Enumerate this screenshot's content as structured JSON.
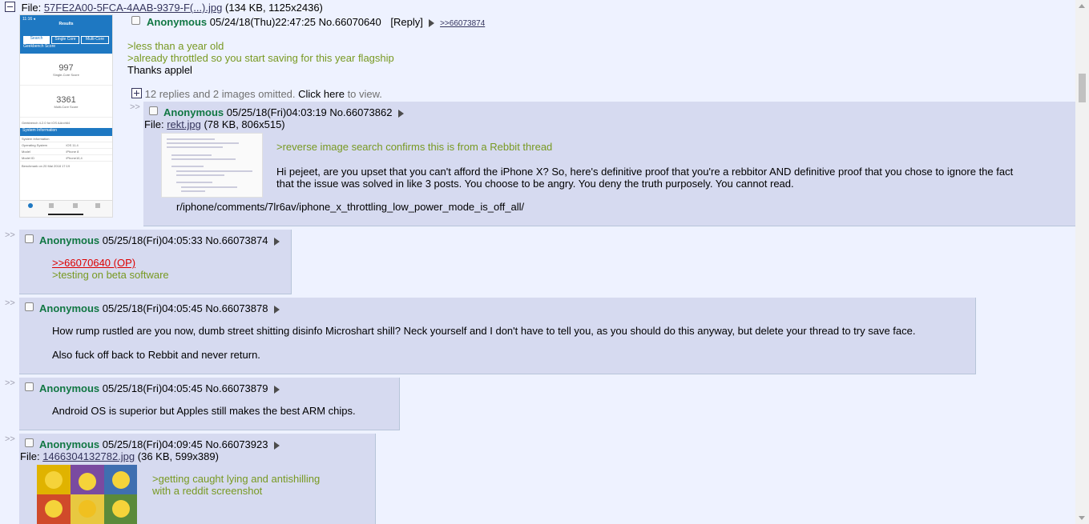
{
  "op": {
    "file_label": "File:",
    "file_name": "57FE2A00-5FCA-4AAB-9379-F(...).jpg",
    "file_info": "(134 KB, 1125x2436)",
    "name": "Anonymous",
    "datetime": "05/24/18(Thu)22:47:25",
    "number": "No.66070640",
    "reply": "[Reply]",
    "backlink": ">>66073874",
    "lines": [
      ">less than a year old",
      ">already throttled so you start saving for this year flagship",
      "Thanks applel"
    ],
    "omitted_text": "12 replies and 2 images omitted.",
    "click_here": "Click here",
    "to_view": "to view.",
    "thumb": {
      "header": "Results",
      "tabs": [
        "Search",
        "Single Core",
        "Multi-Core"
      ],
      "section": "Geekbench Score",
      "single_score": "997",
      "single_label": "Single-Core Score",
      "multi_score": "3361",
      "multi_label": "Multi-Core Score",
      "version": "Geekbench 4.2.0 for iOS AArch64",
      "sysinfo": "System Information",
      "rows": [
        [
          "System Information",
          ""
        ],
        [
          "Operating System",
          "iOS 11.4"
        ],
        [
          "Model",
          "iPhone 8"
        ],
        [
          "Model ID",
          "iPhone10,4"
        ]
      ],
      "footer": "Benchmark on 20 Mai 2018 17:19"
    }
  },
  "posts": [
    {
      "name": "Anonymous",
      "datetime": "05/25/18(Fri)04:03:19",
      "number": "No.66073862",
      "file_label": "File:",
      "file_name": "rekt.jpg",
      "file_info": "(78 KB, 806x515)",
      "quote": ">reverse image search confirms this is from a Rebbit thread",
      "body1": "Hi pejeet, are you upset that you can't afford the iPhone X? So, here's definitive proof that you're a rebbitor AND definitive proof that you chose to ignore the fact",
      "body2": "that the issue was solved in like 3 posts. You choose to be angry. You deny the truth purposely. You cannot read.",
      "body3": "r/iphone/comments/7lr6av/iphone_x_throttling_low_power_mode_is_off_all/"
    },
    {
      "name": "Anonymous",
      "datetime": "05/25/18(Fri)04:05:33",
      "number": "No.66073874",
      "link": ">>66070640 (OP)",
      "quote": ">testing on beta software"
    },
    {
      "name": "Anonymous",
      "datetime": "05/25/18(Fri)04:05:45",
      "number": "No.66073878",
      "body1": "How rump rustled are you now, dumb street shitting disinfo Microshart shill? Neck yourself and I don't have to tell you, as you should do this anyway, but delete your thread to try save face.",
      "body2": "Also fuck off back to Rebbit and never return."
    },
    {
      "name": "Anonymous",
      "datetime": "05/25/18(Fri)04:05:45",
      "number": "No.66073879",
      "body1": "Android OS is superior but Apples still makes the best ARM chips."
    },
    {
      "name": "Anonymous",
      "datetime": "05/25/18(Fri)04:09:45",
      "number": "No.66073923",
      "file_label": "File:",
      "file_name": "1466304132782.jpg",
      "file_info": "(36 KB, 599x389)",
      "quote1": ">getting caught lying and antishilling",
      "quote2": "with a reddit screenshot"
    }
  ],
  "side_marker": ">>",
  "colors": {
    "background": "#eef2ff",
    "post": "#d6daf0",
    "name": "#117743",
    "quote": "#789922",
    "link": "#34345c"
  }
}
